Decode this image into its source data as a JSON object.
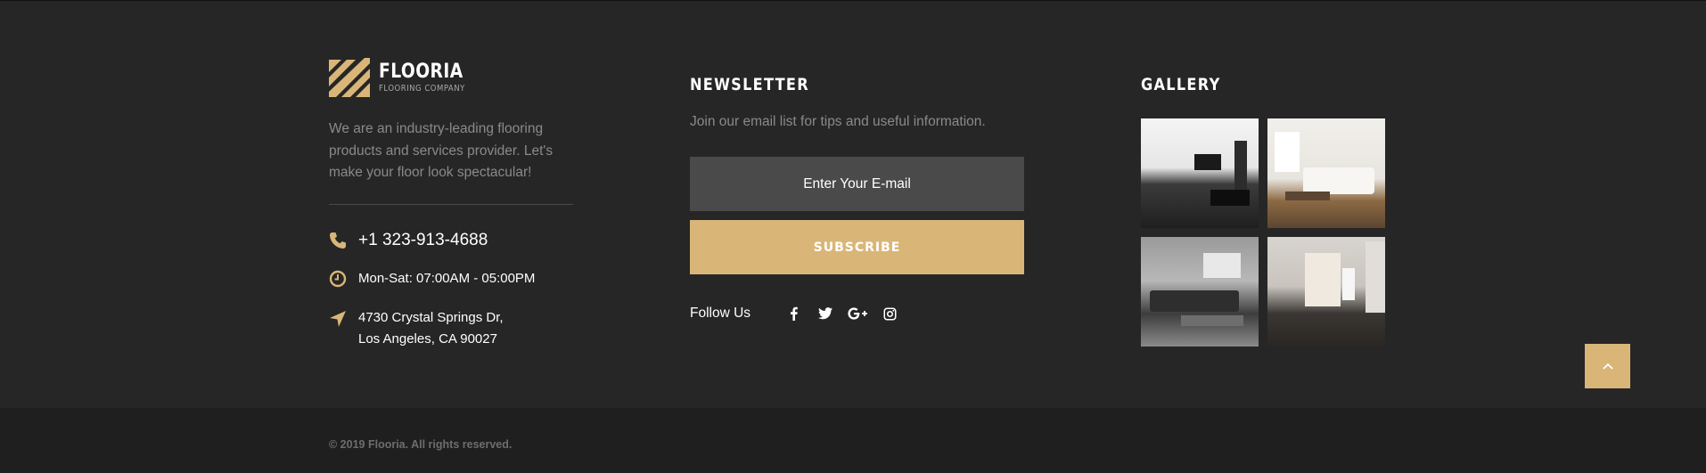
{
  "brand": {
    "name": "FLOORIA",
    "tagline": "FLOORING COMPANY",
    "about": "We are an industry-leading flooring products and services provider. Let's make your floor look spectacular!",
    "accent_color": "#d9b678"
  },
  "contact": {
    "phone": "+1 323-913-4688",
    "hours": "Mon-Sat: 07:00AM - 05:00PM",
    "address_line1": "4730 Crystal Springs Dr,",
    "address_line2": "Los Angeles, CA 90027"
  },
  "newsletter": {
    "heading": "NEWSLETTER",
    "description": "Join our email list for tips and useful information.",
    "input_placeholder": "Enter Your E-mail",
    "subscribe_label": "SUBSCRIBE",
    "follow_label": "Follow Us",
    "social_icons": [
      "facebook-icon",
      "twitter-icon",
      "google-plus-icon",
      "instagram-icon"
    ]
  },
  "gallery": {
    "heading": "GALLERY",
    "images": [
      "gallery-image-living-room-dark-floor",
      "gallery-image-white-sofa",
      "gallery-image-grey-sectional",
      "gallery-image-hallway-dark-floor"
    ]
  },
  "footer": {
    "copyright": "© 2019 Flooria. All rights reserved."
  }
}
